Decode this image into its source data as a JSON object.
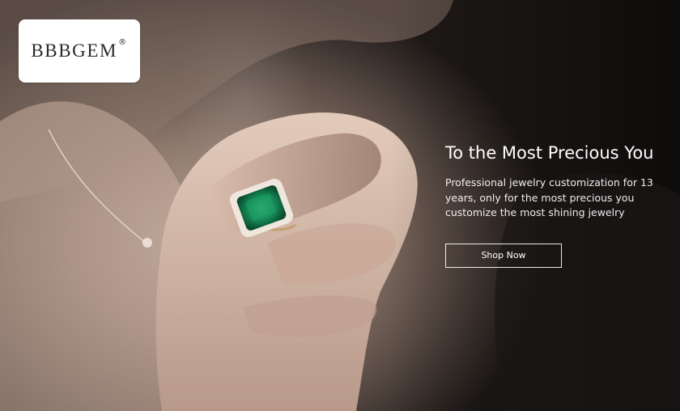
{
  "brand": {
    "name": "BBBGEM",
    "registered_mark": "®"
  },
  "hero": {
    "headline": "To the Most Precious You",
    "subtitle": "Professional jewelry customization for 13 years, only for the most precious you customize the most shining jewelry",
    "cta_label": "Shop Now",
    "image_subject": "hand-with-emerald-ring",
    "accent_color": "#1f8c5a"
  }
}
